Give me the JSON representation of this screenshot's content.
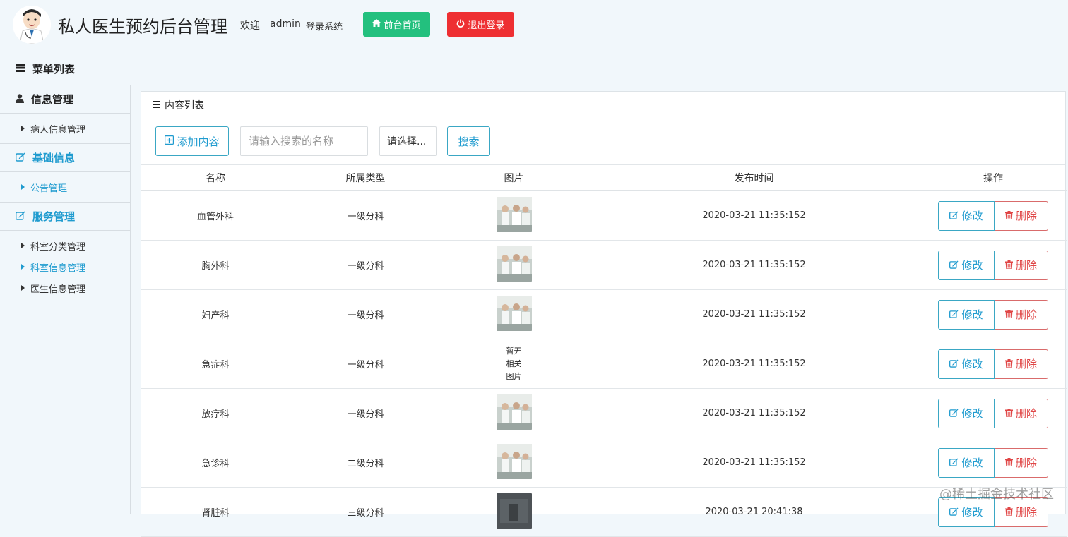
{
  "header": {
    "title": "私人医生预约后台管理",
    "welcome": "欢迎",
    "user": "admin",
    "system": "登录系统",
    "home_button": "前台首页",
    "logout_button": "退出登录"
  },
  "sidebar": {
    "menu_title": "菜单列表",
    "groups": [
      {
        "label": "信息管理",
        "icon": "user-icon",
        "items": [
          "病人信息管理"
        ]
      },
      {
        "label": "基础信息",
        "icon": "edit-icon",
        "items": [
          "公告管理"
        ]
      },
      {
        "label": "服务管理",
        "icon": "edit-icon",
        "items": [
          "科室分类管理",
          "科室信息管理",
          "医生信息管理"
        ],
        "active_item": "科室信息管理"
      }
    ]
  },
  "panel": {
    "title": "内容列表",
    "add_button": "添加内容",
    "search_placeholder": "请输入搜索的名称",
    "select_value": "请选择...",
    "search_button": "搜索"
  },
  "table": {
    "columns": [
      "名称",
      "所属类型",
      "图片",
      "发布时间",
      "操作"
    ],
    "edit_label": "修改",
    "delete_label": "删除",
    "no_image_text": "暂无相关图片",
    "rows": [
      {
        "name": "血管外科",
        "type": "一级分科",
        "time": "2020-03-21 11:35:152",
        "image": "photo"
      },
      {
        "name": "胸外科",
        "type": "一级分科",
        "time": "2020-03-21 11:35:152",
        "image": "photo"
      },
      {
        "name": "妇产科",
        "type": "一级分科",
        "time": "2020-03-21 11:35:152",
        "image": "photo"
      },
      {
        "name": "急症科",
        "type": "一级分科",
        "time": "2020-03-21 11:35:152",
        "image": "none"
      },
      {
        "name": "放疗科",
        "type": "一级分科",
        "time": "2020-03-21 11:35:152",
        "image": "photo"
      },
      {
        "name": "急诊科",
        "type": "二级分科",
        "time": "2020-03-21 11:35:152",
        "image": "photo"
      },
      {
        "name": "肾脏科",
        "type": "三级分科",
        "time": "2020-03-21 20:41:38",
        "image": "photo-dark"
      }
    ]
  },
  "watermark": "@稀土掘金技术社区",
  "colors": {
    "primary": "#1f9bcf",
    "success": "#23c07e",
    "danger": "#ee2f32"
  }
}
